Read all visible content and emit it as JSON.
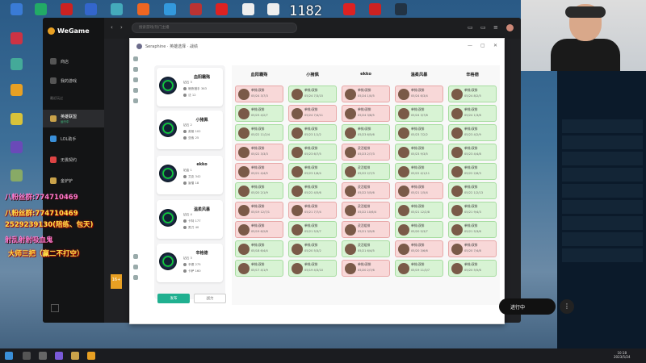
{
  "window": {
    "app_name": "WeGame"
  },
  "overlay": {
    "fps": "1182",
    "lines": [
      "八粉丝群:774710469",
      "2529239130(陪练、包天)",
      "射乱射射吸血鬼",
      "大师三把（赢二不打空）"
    ]
  },
  "wegame": {
    "nav": [
      {
        "label": "商店"
      },
      {
        "label": "我的游戏"
      }
    ],
    "recent_label": "最近玩过",
    "games": [
      {
        "label": "英雄联盟",
        "sub": "运行中"
      },
      {
        "label": "LOL助手"
      },
      {
        "label": "无畏契约"
      },
      {
        "label": "金铲铲"
      }
    ],
    "search_placeholder": "搜索游戏/热门主播"
  },
  "app": {
    "breadcrumb": "Seraphine · 英雄选择 · 战绩",
    "buttons": {
      "primary": "发布",
      "secondary": "战力"
    },
    "players": [
      {
        "name": "血阳霜殇",
        "rank": "钻石 3",
        "champs": [
          {
            "name": "暗夜猎手",
            "n": "363"
          },
          {
            "name": "法",
            "n": "12"
          }
        ]
      },
      {
        "name": "小猪佩",
        "rank": "钻石 2",
        "champs": [
          {
            "name": "英雄",
            "n": "102"
          },
          {
            "name": "亚索",
            "n": "25"
          }
        ]
      },
      {
        "name": "ekko",
        "rank": "铂金 1",
        "champs": [
          {
            "name": "艾克",
            "n": "342"
          },
          {
            "name": "盲僧",
            "n": "18"
          }
        ]
      },
      {
        "name": "温柔风暴",
        "rank": "钻石 4",
        "champs": [
          {
            "name": "卡特",
            "n": "177"
          },
          {
            "name": "男刀",
            "n": "40"
          }
        ]
      },
      {
        "name": "辛格德",
        "rank": "钻石 3",
        "champs": [
          {
            "name": "辛德",
            "n": "275"
          },
          {
            "name": "卡萨",
            "n": "160"
          }
        ]
      }
    ],
    "columns": [
      {
        "name": "血阳霜殇",
        "matches": [
          {
            "mode": "单排/双排",
            "date": "05/24",
            "kda": "3/7/3",
            "win": false
          },
          {
            "mode": "单排/双排",
            "date": "05/23",
            "kda": "4/2/7",
            "win": true
          },
          {
            "mode": "单排/双排",
            "date": "05/22",
            "kda": "11/2/4",
            "win": true
          },
          {
            "mode": "单排/双排",
            "date": "05/22",
            "kda": "3/3/3",
            "win": false
          },
          {
            "mode": "单排/双排",
            "date": "05/21",
            "kda": "4/4/5",
            "win": false
          },
          {
            "mode": "单排/双排",
            "date": "05/20",
            "kda": "2/1/9",
            "win": true
          },
          {
            "mode": "单排/双排",
            "date": "05/19",
            "kda": "12/7/1",
            "win": false
          },
          {
            "mode": "单排/双排",
            "date": "05/19",
            "kda": "6/2/8",
            "win": false
          },
          {
            "mode": "单排/双排",
            "date": "05/18",
            "kda": "6/4/4",
            "win": true
          },
          {
            "mode": "单排/双排",
            "date": "05/17",
            "kda": "4/1/9",
            "win": true
          }
        ]
      },
      {
        "name": "小猪佩",
        "matches": [
          {
            "mode": "单排/双排",
            "date": "05/24",
            "kda": "7/3/15",
            "win": true
          },
          {
            "mode": "单排/双排",
            "date": "05/24",
            "kda": "7/4/11",
            "win": false
          },
          {
            "mode": "单排/双排",
            "date": "05/23",
            "kda": "1/1/2",
            "win": true
          },
          {
            "mode": "单排/双排",
            "date": "05/23",
            "kda": "6/7/5",
            "win": true
          },
          {
            "mode": "单排/双排",
            "date": "05/23",
            "kda": "1/6/4",
            "win": true
          },
          {
            "mode": "单排/双排",
            "date": "05/22",
            "kda": "4/5/6",
            "win": true
          },
          {
            "mode": "单排/双排",
            "date": "05/21",
            "kda": "7/7/4",
            "win": false
          },
          {
            "mode": "单排/双排",
            "date": "05/21",
            "kda": "5/3/7",
            "win": true
          },
          {
            "mode": "单排/双排",
            "date": "05/20",
            "kda": "5/3/2",
            "win": true
          },
          {
            "mode": "单排/双排",
            "date": "05/19",
            "kda": "4/3/10",
            "win": true
          }
        ]
      },
      {
        "name": "ekko",
        "matches": [
          {
            "mode": "单排/双排",
            "date": "05/24",
            "kda": "1/0/5",
            "win": false
          },
          {
            "mode": "单排/双排",
            "date": "05/24",
            "kda": "3/8/5",
            "win": false
          },
          {
            "mode": "单排/双排",
            "date": "05/23",
            "kda": "6/5/6",
            "win": true
          },
          {
            "mode": "灵活组排",
            "date": "05/23",
            "kda": "2/7/3",
            "win": false
          },
          {
            "mode": "灵活组排",
            "date": "05/22",
            "kda": "2/7/3",
            "win": true
          },
          {
            "mode": "灵活组排",
            "date": "05/22",
            "kda": "5/5/6",
            "win": false
          },
          {
            "mode": "灵活组排",
            "date": "05/22",
            "kda": "10/6/4",
            "win": false
          },
          {
            "mode": "灵活组排",
            "date": "05/21",
            "kda": "3/5/8",
            "win": false
          },
          {
            "mode": "灵活组排",
            "date": "05/21",
            "kda": "6/4/5",
            "win": true
          },
          {
            "mode": "单排/双排",
            "date": "05/20",
            "kda": "2/7/6",
            "win": false
          }
        ]
      },
      {
        "name": "温柔风暴",
        "matches": [
          {
            "mode": "单排/双排",
            "date": "05/24",
            "kda": "6/3/4",
            "win": false
          },
          {
            "mode": "单排/双排",
            "date": "05/24",
            "kda": "3/7/8",
            "win": true
          },
          {
            "mode": "单排/双排",
            "date": "05/23",
            "kda": "7/2/2",
            "win": true
          },
          {
            "mode": "单排/双排",
            "date": "05/23",
            "kda": "9/3/5",
            "win": true
          },
          {
            "mode": "单排/双排",
            "date": "05/22",
            "kda": "4/1/11",
            "win": true
          },
          {
            "mode": "单排/双排",
            "date": "05/21",
            "kda": "1/5/4",
            "win": false
          },
          {
            "mode": "单排/双排",
            "date": "05/21",
            "kda": "12/2/8",
            "win": true
          },
          {
            "mode": "单排/双排",
            "date": "05/20",
            "kda": "5/3/7",
            "win": true
          },
          {
            "mode": "单排/双排",
            "date": "05/20",
            "kda": "3/6/6",
            "win": false
          },
          {
            "mode": "单排/双排",
            "date": "05/19",
            "kda": "11/3/7",
            "win": true
          }
        ]
      },
      {
        "name": "辛格德",
        "matches": [
          {
            "mode": "单排/双排",
            "date": "05/24",
            "kda": "8/2/5",
            "win": true
          },
          {
            "mode": "单排/双排",
            "date": "05/24",
            "kda": "1/3/8",
            "win": true
          },
          {
            "mode": "单排/双排",
            "date": "05/23",
            "kda": "4/2/9",
            "win": true
          },
          {
            "mode": "单排/双排",
            "date": "05/23",
            "kda": "4/4/8",
            "win": true
          },
          {
            "mode": "单排/双排",
            "date": "05/22",
            "kda": "2/6/3",
            "win": true
          },
          {
            "mode": "单排/双排",
            "date": "05/22",
            "kda": "1/2/13",
            "win": true
          },
          {
            "mode": "单排/双排",
            "date": "05/21",
            "kda": "9/4/3",
            "win": true
          },
          {
            "mode": "单排/双排",
            "date": "05/21",
            "kda": "5/3/6",
            "win": true
          },
          {
            "mode": "单排/双排",
            "date": "05/20",
            "kda": "7/4/8",
            "win": false
          },
          {
            "mode": "单排/双排",
            "date": "05/20",
            "kda": "5/5/6",
            "win": true
          }
        ]
      }
    ]
  },
  "lobby": {
    "status": "进行中"
  },
  "taskbar": {
    "time": "10:18",
    "date": "2023/5/24"
  },
  "colors": {
    "win_bg": "#d8f3d4",
    "loss_bg": "#f8d8d8",
    "accent": "#20b090"
  }
}
